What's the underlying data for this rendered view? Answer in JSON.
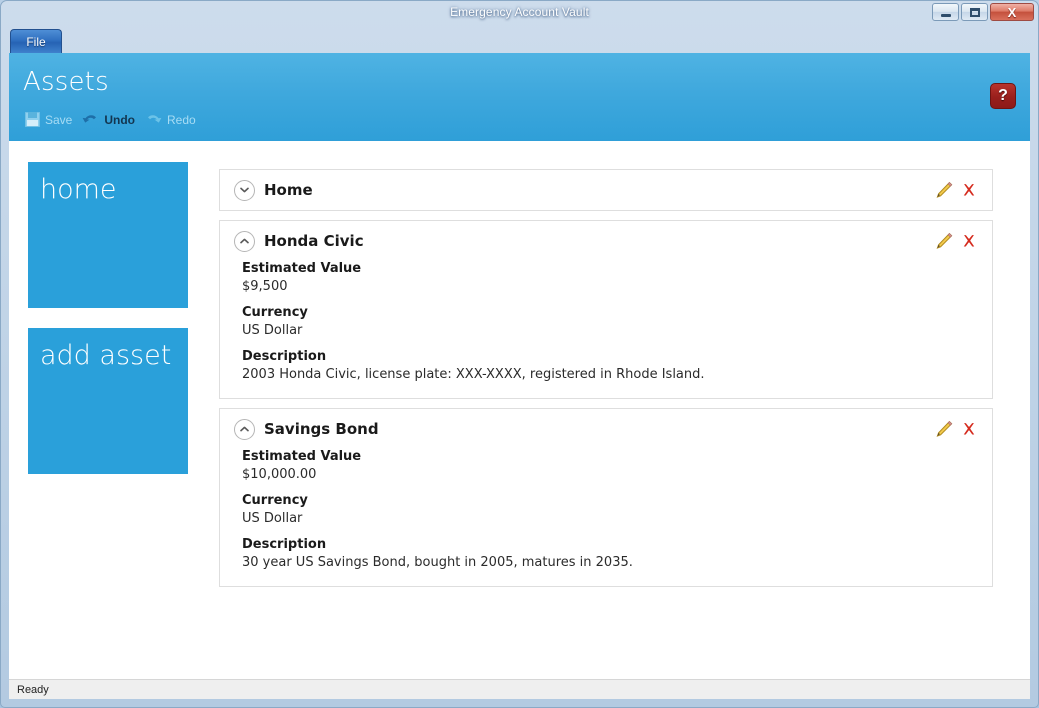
{
  "window": {
    "title": "Emergency Account Vault",
    "controls": {
      "minimize": "minimize",
      "maximize": "maximize",
      "close": "X"
    }
  },
  "menu": {
    "file_label": "File"
  },
  "ribbon": {
    "title": "Assets",
    "tools": [
      {
        "label": "Save",
        "icon": "save-icon",
        "enabled": false
      },
      {
        "label": "Undo",
        "icon": "undo-icon",
        "enabled": true
      },
      {
        "label": "Redo",
        "icon": "redo-icon",
        "enabled": false
      }
    ],
    "help_label": "?",
    "accent_color": "#3fa8dd"
  },
  "sidebar": {
    "tiles": [
      {
        "label": "home",
        "color": "#2aa0da"
      },
      {
        "label": "add asset",
        "color": "#2aa0da"
      }
    ]
  },
  "main": {
    "cards": [
      {
        "title": "Home",
        "expanded": false,
        "fields": []
      },
      {
        "title": "Honda Civic",
        "expanded": true,
        "fields": [
          {
            "label": "Estimated Value",
            "value": "$9,500"
          },
          {
            "label": "Currency",
            "value": "US Dollar"
          },
          {
            "label": "Description",
            "value": "2003 Honda Civic, license plate: XXX-XXXX, registered in Rhode Island."
          }
        ]
      },
      {
        "title": "Savings Bond",
        "expanded": true,
        "fields": [
          {
            "label": "Estimated Value",
            "value": "$10,000.00"
          },
          {
            "label": "Currency",
            "value": "US Dollar"
          },
          {
            "label": "Description",
            "value": "30 year US Savings Bond, bought in 2005, matures in 2035."
          }
        ]
      }
    ],
    "row_actions": {
      "edit": "edit-pencil-icon",
      "delete": "delete-x-icon"
    }
  },
  "statusbar": {
    "text": "Ready"
  }
}
